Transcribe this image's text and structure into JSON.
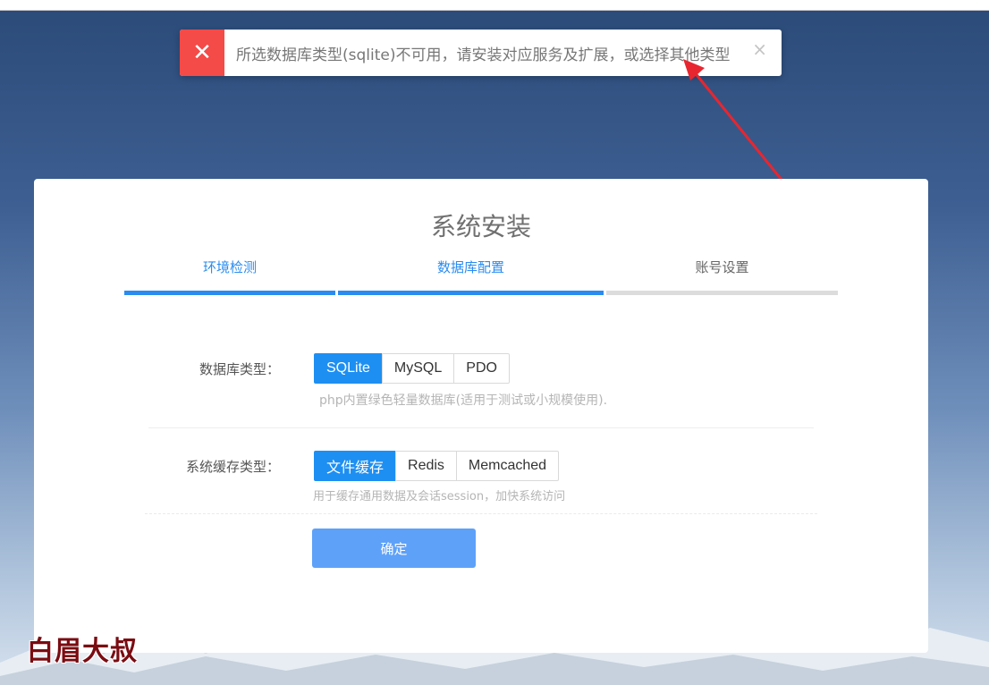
{
  "toast": {
    "icon": "close-icon",
    "message": "所选数据库类型(sqlite)不可用，请安装对应服务及扩展，或选择其他类型",
    "close_glyph": "×"
  },
  "card": {
    "title": "系统安装",
    "steps": [
      {
        "label": "环境检测",
        "state": "done"
      },
      {
        "label": "数据库配置",
        "state": "done"
      },
      {
        "label": "账号设置",
        "state": "todo"
      }
    ],
    "db": {
      "label": "数据库类型：",
      "options": [
        "SQLite",
        "MySQL",
        "PDO"
      ],
      "selected": "SQLite",
      "hint": "php内置绿色轻量数据库(适用于测试或小规模使用)."
    },
    "cache": {
      "label": "系统缓存类型：",
      "options": [
        "文件缓存",
        "Redis",
        "Memcached"
      ],
      "selected": "文件缓存",
      "hint": "用于缓存通用数据及会话session，加快系统访问"
    },
    "confirm_label": "确定"
  },
  "watermark": "白眉大叔",
  "colors": {
    "accent": "#1e8ff2",
    "error": "#f44a48",
    "confirm": "#5ea1f9",
    "annotation_arrow": "#e8262f"
  }
}
